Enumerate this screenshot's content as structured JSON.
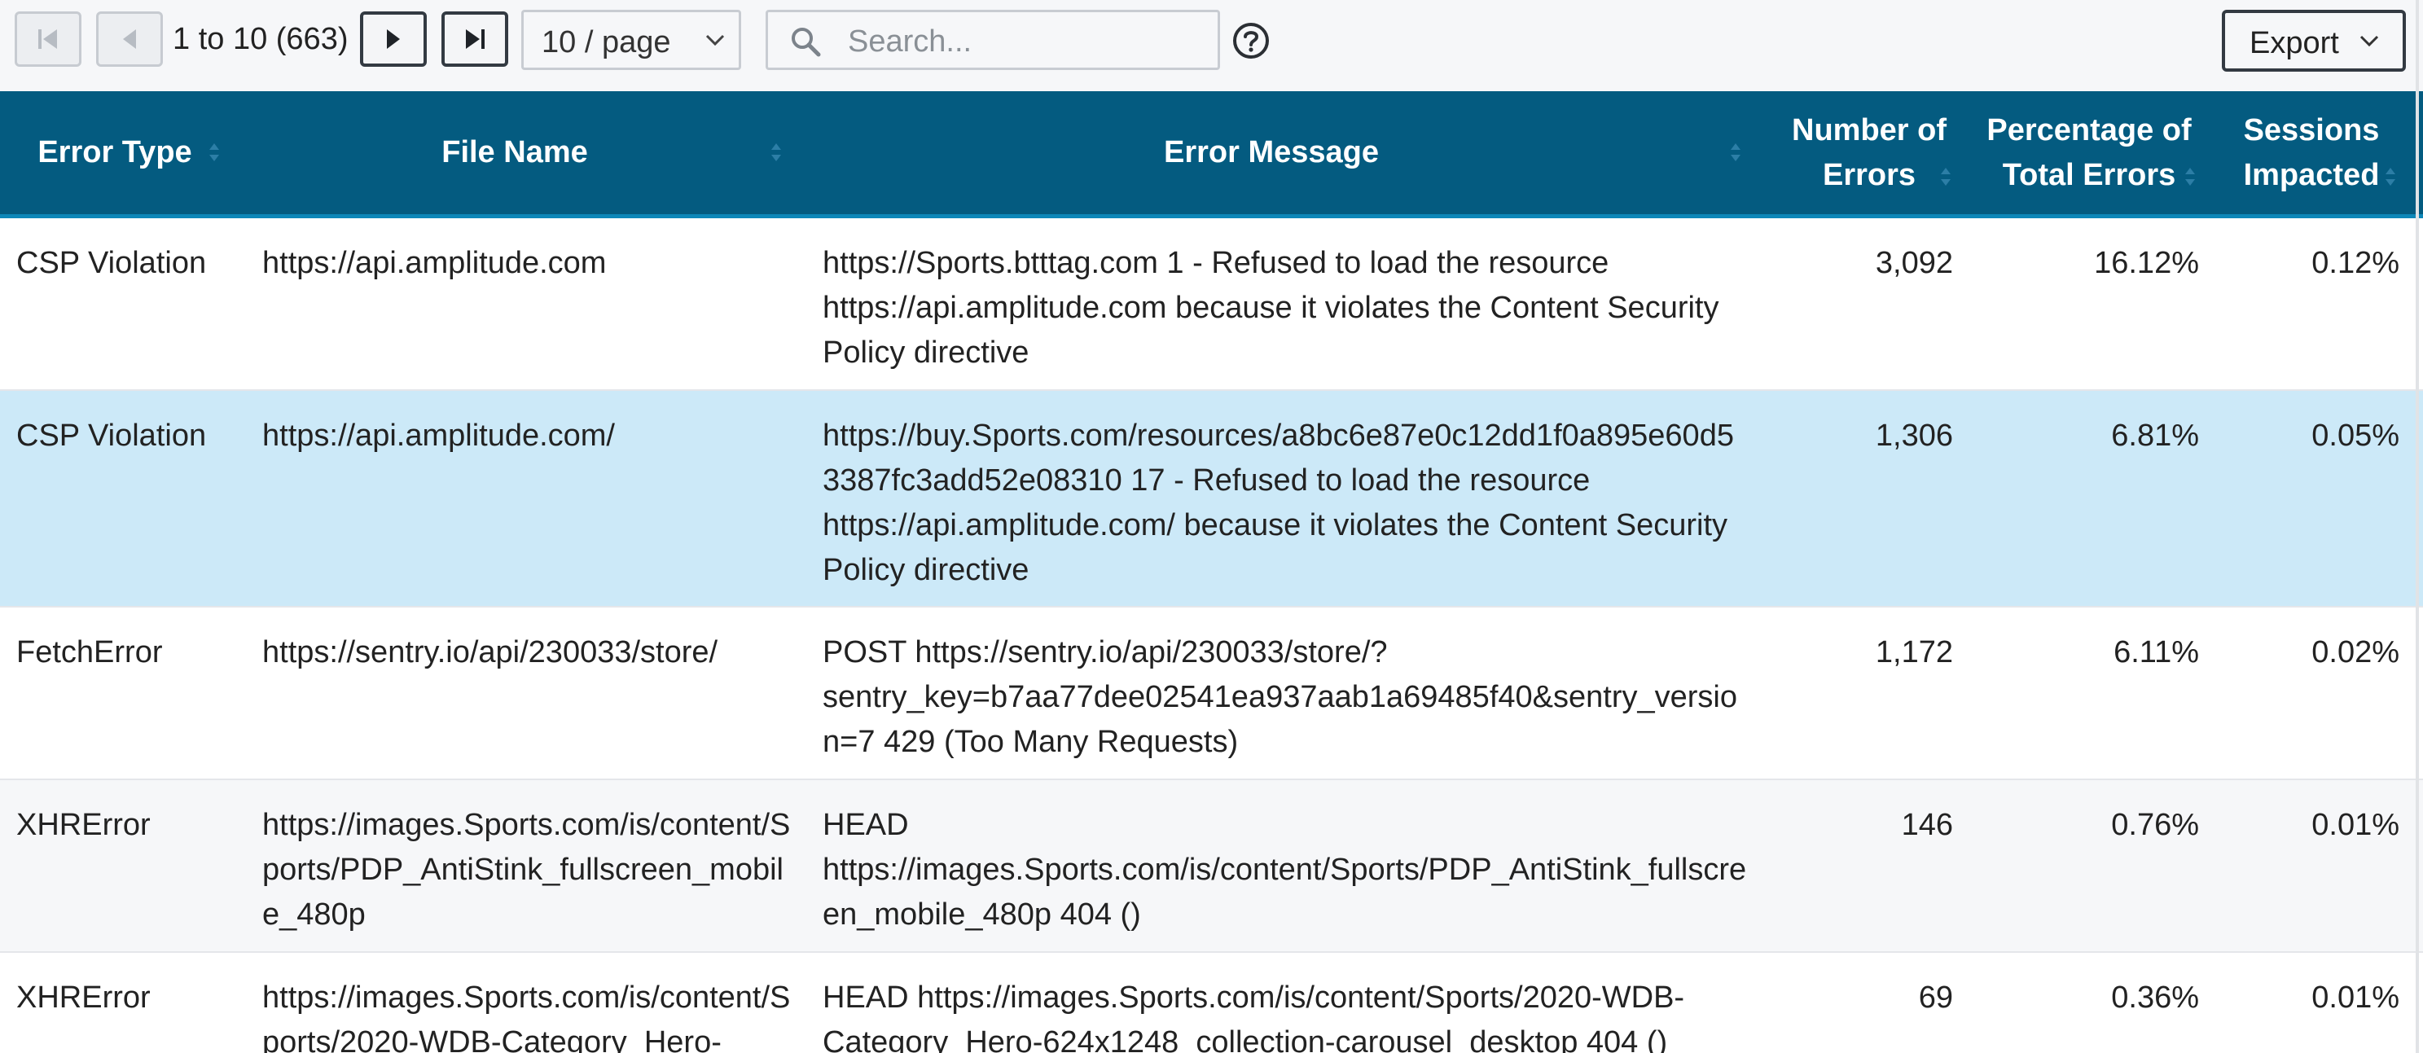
{
  "pagination": {
    "range_text": "1 to 10 (663)",
    "page_size": "10 / page"
  },
  "search": {
    "placeholder": "Search..."
  },
  "export": {
    "label": "Export"
  },
  "icons": {
    "first": "first-page-icon",
    "prev": "prev-page-icon",
    "next": "next-page-icon",
    "last": "last-page-icon",
    "search": "search-icon",
    "help": "help-circle-icon",
    "chevron": "chevron-down-icon",
    "sort": "sort-icon"
  },
  "colors": {
    "header_bg": "#045b80",
    "header_accent": "#0d87b8",
    "row_selected": "#cce9f8",
    "row_alt": "#f6f7f9"
  },
  "table": {
    "columns": [
      {
        "key": "error_type",
        "line1": "Error Type",
        "line2": ""
      },
      {
        "key": "file_name",
        "line1": "File Name",
        "line2": ""
      },
      {
        "key": "error_message",
        "line1": "Error Message",
        "line2": ""
      },
      {
        "key": "num_errors",
        "line1": "Number of",
        "line2": "Errors"
      },
      {
        "key": "pct_errors",
        "line1": "Percentage of",
        "line2": "Total Errors"
      },
      {
        "key": "sessions",
        "line1": "Sessions",
        "line2": "Impacted"
      }
    ],
    "rows": [
      {
        "error_type": "CSP Violation",
        "file_name": "https://api.amplitude.com",
        "error_message": "https://Sports.btttag.com 1 - Refused to load the resource https://api.amplitude.com because it violates the Content Security Policy directive",
        "num_errors": "3,092",
        "pct_errors": "16.12%",
        "sessions": "0.12%",
        "selected": false
      },
      {
        "error_type": "CSP Violation",
        "file_name": "https://api.amplitude.com/",
        "error_message": "https://buy.Sports.com/resources/a8bc6e87e0c12dd1f0a895e60d53387fc3add52e08310 17 - Refused to load the resource https://api.amplitude.com/ because it violates the Content Security Policy directive",
        "num_errors": "1,306",
        "pct_errors": "6.81%",
        "sessions": "0.05%",
        "selected": true
      },
      {
        "error_type": "FetchError",
        "file_name": "https://sentry.io/api/230033/store/",
        "error_message": "POST https://sentry.io/api/230033/store/?sentry_key=b7aa77dee02541ea937aab1a69485f40&sentry_version=7 429 (Too Many Requests)",
        "num_errors": "1,172",
        "pct_errors": "6.11%",
        "sessions": "0.02%",
        "selected": false
      },
      {
        "error_type": "XHRError",
        "file_name": "https://images.Sports.com/is/content/Sports/PDP_AntiStink_fullscreen_mobile_480p",
        "error_message": "HEAD https://images.Sports.com/is/content/Sports/PDP_AntiStink_fullscreen_mobile_480p 404 ()",
        "num_errors": "146",
        "pct_errors": "0.76%",
        "sessions": "0.01%",
        "selected": false
      },
      {
        "error_type": "XHRError",
        "file_name": "https://images.Sports.com/is/content/Sports/2020-WDB-Category_Hero-",
        "error_message": "HEAD https://images.Sports.com/is/content/Sports/2020-WDB-Category_Hero-624x1248_collection-carousel_desktop 404 ()",
        "num_errors": "69",
        "pct_errors": "0.36%",
        "sessions": "0.01%",
        "selected": false
      }
    ]
  }
}
